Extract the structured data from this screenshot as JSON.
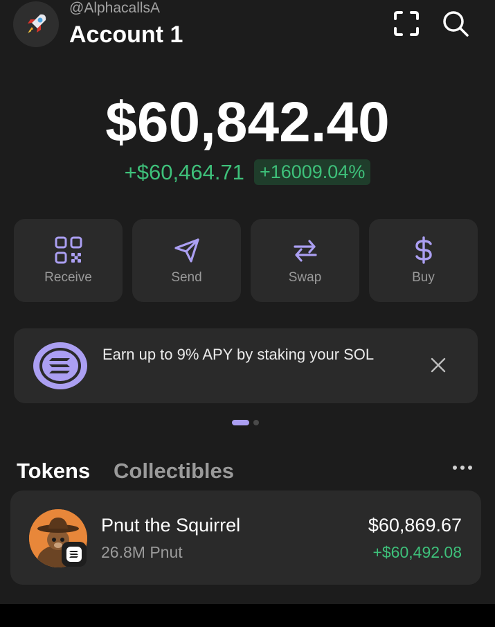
{
  "header": {
    "handle": "@AlphacallsA",
    "account_name": "Account 1",
    "avatar_icon": "rocket-icon"
  },
  "balance": {
    "total": "$60,842.40",
    "change_usd": "+$60,464.71",
    "change_pct": "+16009.04%"
  },
  "actions": [
    {
      "label": "Receive",
      "icon": "qr-code-icon"
    },
    {
      "label": "Send",
      "icon": "paper-plane-icon"
    },
    {
      "label": "Swap",
      "icon": "swap-arrows-icon"
    },
    {
      "label": "Buy",
      "icon": "dollar-icon"
    }
  ],
  "banner": {
    "text": "Earn up to 9% APY by staking your SOL",
    "icon": "solana-icon"
  },
  "pager": {
    "pages": 2,
    "active": 1
  },
  "tabs": [
    {
      "label": "Tokens",
      "active": true
    },
    {
      "label": "Collectibles",
      "active": false
    }
  ],
  "tokens": [
    {
      "name": "Pnut the Squirrel",
      "amount": "26.8M Pnut",
      "value": "$60,869.67",
      "change": "+$60,492.08"
    }
  ],
  "colors": {
    "accent_purple": "#ab9ff2",
    "positive_green": "#3ec07a",
    "card_bg": "#2a2a2a",
    "screen_bg": "#1c1c1c"
  }
}
